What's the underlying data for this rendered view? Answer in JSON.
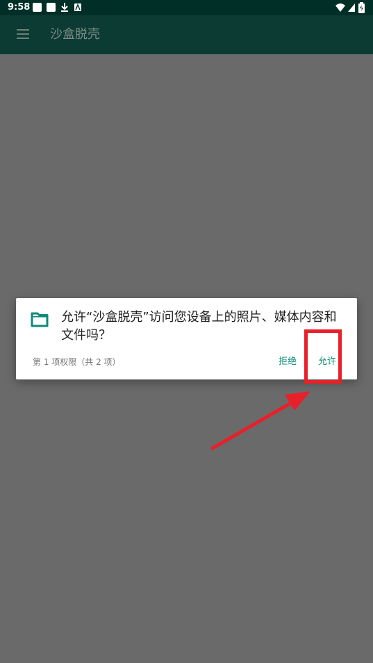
{
  "status_bar": {
    "time": "9:58"
  },
  "app_bar": {
    "title": "沙盒脱壳"
  },
  "dialog": {
    "message": "允许“沙盒脱壳”访问您设备上的照片、媒体内容和文件吗？",
    "counter": "第 1 项权限（共 2 项）",
    "deny_label": "拒绝",
    "allow_label": "允许",
    "icon": "folder-icon"
  },
  "colors": {
    "status_bar_bg": "#002f27",
    "app_bar_bg": "#0b3b33",
    "scrim": "#6a6a6a",
    "accent": "#0b8a7a",
    "annotation_red": "#e8202a"
  }
}
